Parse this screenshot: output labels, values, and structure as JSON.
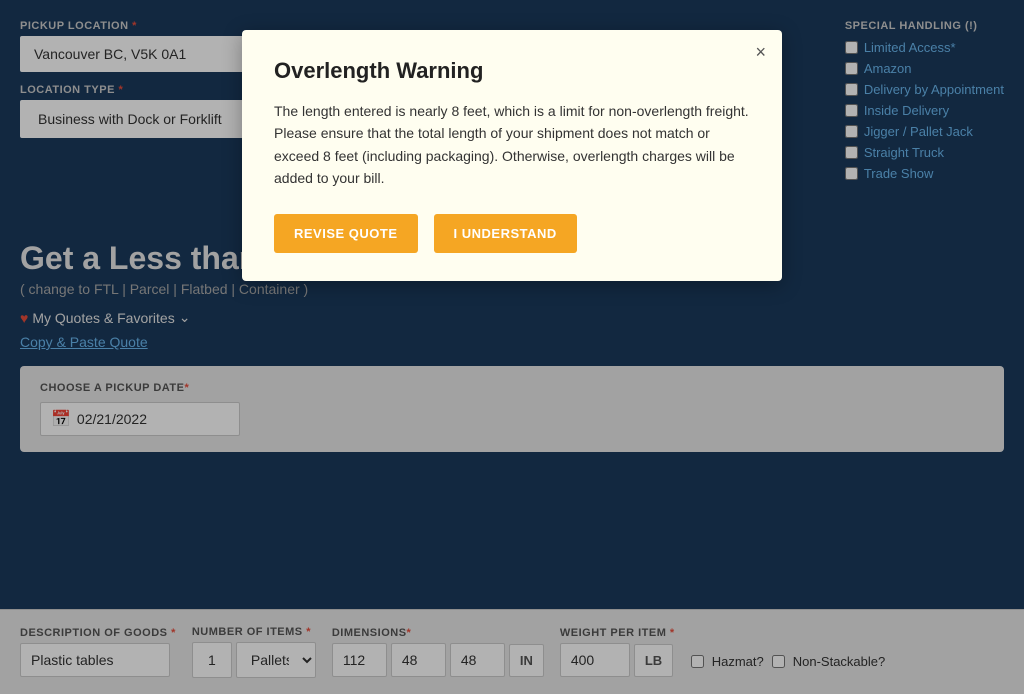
{
  "pickup": {
    "label": "PICKUP LOCATION",
    "required": true,
    "value": "Vancouver BC, V5K 0A1"
  },
  "location_type": {
    "label": "LOCATION TYPE",
    "required": true,
    "value": "Business with Dock or Forklift"
  },
  "special_handling": {
    "label": "SPECIAL HANDLING",
    "hint": "(!)",
    "items": [
      {
        "id": "limited-access",
        "label": "Limited Access*"
      },
      {
        "id": "amazon",
        "label": "Amazon"
      },
      {
        "id": "delivery-appointment",
        "label": "Delivery by Appointment"
      },
      {
        "id": "inside-delivery",
        "label": "Inside Delivery"
      },
      {
        "id": "jigger-pallet",
        "label": "Jigger / Pallet Jack"
      },
      {
        "id": "straight-truck",
        "label": "Straight Truck"
      },
      {
        "id": "trade-show",
        "label": "Trade Show"
      }
    ]
  },
  "quote_title": "Get a Less than Truckload (LTL) Quote",
  "change_links": "( change to FTL | Parcel | Flatbed | Container )",
  "my_quotes_label": "My Quotes & Favorites",
  "copy_paste_label": "Copy & Paste Quote",
  "date_section": {
    "label": "CHOOSE A PICKUP DATE",
    "required": true,
    "value": "02/21/2022"
  },
  "goods_section": {
    "description_label": "DESCRIPTION OF GOODS",
    "description_required": true,
    "description_value": "Plastic tables",
    "num_items_label": "NUMBER OF ITEMS",
    "num_items_required": true,
    "num_items_value": "1",
    "unit_value": "Pallets",
    "dimensions_label": "DIMENSIONS",
    "dimensions_required": true,
    "dim1": "112",
    "dim2": "48",
    "dim3": "48",
    "dim_unit": "IN",
    "weight_label": "WEIGHT PER ITEM",
    "weight_required": true,
    "weight_value": "400",
    "weight_unit": "LB",
    "hazmat_label": "Hazmat?",
    "non_stackable_label": "Non-Stackable?"
  },
  "modal": {
    "title": "Overlength Warning",
    "body": "The length entered is nearly 8 feet, which is a limit for non-overlength freight. Please ensure that the total length of your shipment does not match or exceed 8 feet (including packaging). Otherwise, overlength charges will be added to your bill.",
    "revise_label": "REVISE QUOTE",
    "understand_label": "I UNDERSTAND",
    "close_label": "×"
  }
}
